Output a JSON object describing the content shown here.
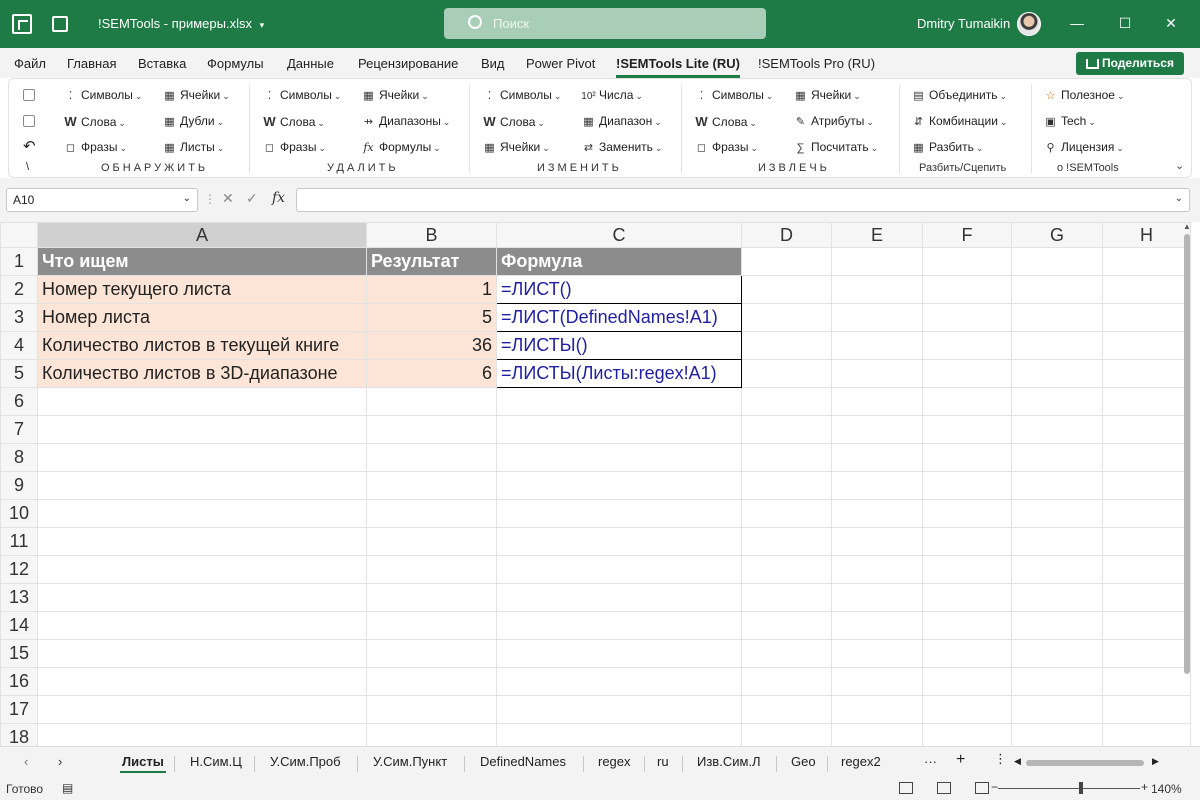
{
  "window": {
    "title": "!SEMTools - примеры.xlsx",
    "search_placeholder": "Поиск",
    "user_name": "Dmitry Tumaikin",
    "minimize": "—",
    "maximize": "☐",
    "close": "✕"
  },
  "ribbon_tabs": [
    "Файл",
    "Главная",
    "Вставка",
    "Формулы",
    "Данные",
    "Рецензирование",
    "Вид",
    "Power Pivot",
    "!SEMTools Lite (RU)",
    "!SEMTools Pro (RU)"
  ],
  "share_label": "Поделиться",
  "ribbon": {
    "groups": [
      {
        "label": "ОБНАРУЖИТЬ",
        "col1": [
          "Символы",
          "Слова",
          "Фразы"
        ],
        "col2": [
          "Ячейки",
          "Дубли",
          "Листы"
        ]
      },
      {
        "label": "УДАЛИТЬ",
        "col1": [
          "Символы",
          "Слова",
          "Фразы"
        ],
        "col2": [
          "Ячейки",
          "Диапазоны",
          "Формулы"
        ]
      },
      {
        "label": "ИЗМЕНИТЬ",
        "col1": [
          "Символы",
          "Слова",
          "Ячейки"
        ],
        "col2": [
          "Числа",
          "Диапазон",
          "Заменить"
        ]
      },
      {
        "label": "ИЗВЛЕЧЬ",
        "col1": [
          "Символы",
          "Слова",
          "Фразы"
        ],
        "col2": [
          "Ячейки",
          "Атрибуты",
          "Посчитать"
        ]
      },
      {
        "label": "Разбить/Сцепить",
        "col1": [
          "Объединить",
          "Комбинации",
          "Разбить"
        ]
      },
      {
        "label": "о !SEMTools",
        "col1": [
          "Полезное",
          "Tech",
          "Лицензия"
        ]
      }
    ],
    "left_glyph": "\\"
  },
  "formula_bar": {
    "name_box": "A10",
    "fx": "fx",
    "value": ""
  },
  "sheet": {
    "columns": [
      "A",
      "B",
      "C",
      "D",
      "E",
      "F",
      "G",
      "H"
    ],
    "rows": [
      "1",
      "2",
      "3",
      "4",
      "5",
      "6",
      "7",
      "8",
      "9",
      "10",
      "11",
      "12",
      "13",
      "14",
      "15",
      "16",
      "17",
      "18"
    ],
    "header": [
      "Что ищем",
      "Результат",
      "Формула"
    ],
    "data": [
      [
        "Номер текущего листа",
        "1",
        "=ЛИСТ()"
      ],
      [
        "Номер листа",
        "5",
        "=ЛИСТ(DefinedNames!A1)"
      ],
      [
        "Количество листов в текущей книге",
        "36",
        "=ЛИСТЫ()"
      ],
      [
        "Количество листов в 3D-диапазоне",
        "6",
        "=ЛИСТЫ(Листы:regex!A1)"
      ]
    ]
  },
  "sheet_tabs": [
    "Листы",
    "Н.Сим.Ц",
    "У.Сим.Проб",
    "У.Сим.Пункт",
    "DefinedNames",
    "regex",
    "ru",
    "Изв.Сим.Л",
    "Geo",
    "regex2"
  ],
  "sheet_tabs_more": "···",
  "sheet_tabs_add": "+",
  "status": {
    "ready": "Готово",
    "zoom": "140%"
  },
  "colors": {
    "excel_green": "#1e7b45",
    "header_fill": "#8c8c8c",
    "peach_fill": "#fce4d6",
    "formula_text": "#1f1fa5"
  }
}
